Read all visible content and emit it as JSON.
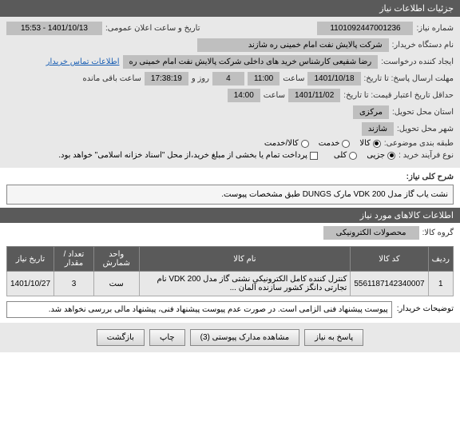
{
  "header": {
    "title": "جزئیات اطلاعات نیاز"
  },
  "fields": {
    "need_no_label": "شماره نیاز:",
    "need_no": "1101092447001236",
    "announce_label": "تاریخ و ساعت اعلان عمومی:",
    "announce": "1401/10/13 - 15:53",
    "buyer_org_label": "نام دستگاه خریدار:",
    "buyer_org": "شرکت پالایش نفت امام خمینی  ره  شازند",
    "creator_label": "ایجاد کننده درخواست:",
    "creator": "رضا  شفیعی  کارشناس خرید های داخلی  شرکت پالایش نفت امام خمینی  ره",
    "contact_link": "اطلاعات تماس خریدار",
    "deadline_label": "مهلت ارسال پاسخ: تا تاریخ:",
    "deadline_date": "1401/10/18",
    "time_label": "ساعت",
    "deadline_time": "11:00",
    "days": "4",
    "days_label": "روز و",
    "countdown": "17:38:19",
    "countdown_label": "ساعت باقی مانده",
    "price_valid_label": "حداقل تاریخ اعتبار قیمت: تا تاریخ:",
    "price_valid_date": "1401/11/02",
    "price_valid_time": "14:00",
    "province_label": "استان محل تحویل:",
    "province": "مرکزی",
    "city_label": "شهر محل تحویل:",
    "city": "شازند",
    "category_label": "طبقه بندی موضوعی:",
    "cat_goods": "کالا",
    "cat_service": "خدمت",
    "cat_goods_service": "کالا/خدمت",
    "process_label": "نوع فرآیند خرید :",
    "proc_partial": "جزیی",
    "proc_full": "کلی",
    "payment_note": "پرداخت تمام یا بخشی از مبلغ خرید،از محل \"اسناد خزانه اسلامی\" خواهد بود.",
    "summary_label": "شرح کلی نیاز:",
    "summary": "نشت یاب گاز مدل VDK 200 مارک DUNGS طبق مشخصات پیوست.",
    "section_items": "اطلاعات کالاهای مورد نیاز",
    "group_label": "گروه کالا:",
    "group": "محصولات الکترونیکی"
  },
  "table": {
    "headers": {
      "row": "ردیف",
      "code": "کد کالا",
      "name": "نام کالا",
      "unit": "واحد شمارش",
      "qty": "تعداد / مقدار",
      "date": "تاریخ نیاز"
    },
    "rows": [
      {
        "row": "1",
        "code": "5561187142340007",
        "name": "کنترل کننده کامل الکترونیکی نشتی گاز مدل VDK 200 نام تجارتی دانگز کشور سازنده آلمان ...",
        "unit": "ست",
        "qty": "3",
        "date": "1401/10/27"
      }
    ]
  },
  "buyer_note": {
    "label": "توضیحات خریدار:",
    "text": "پیوست پیشنهاد فنی الزامی است. در صورت عدم پیوست پیشنهاد فنی، پیشنهاد مالی بررسی نخواهد شد."
  },
  "buttons": {
    "reply": "پاسخ به نیاز",
    "attachments": "مشاهده مدارک پیوستی (3)",
    "print": "چاپ",
    "back": "بازگشت"
  }
}
